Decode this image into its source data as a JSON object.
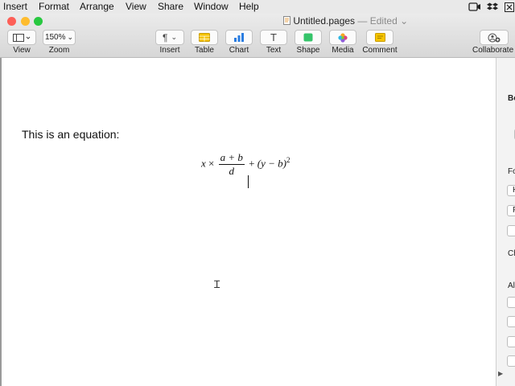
{
  "menubar": {
    "items": [
      "Insert",
      "Format",
      "Arrange",
      "View",
      "Share",
      "Window",
      "Help"
    ]
  },
  "window": {
    "title": "Untitled.pages",
    "status": "— Edited",
    "traffic_colors": [
      "#fd5f57",
      "#febc2e",
      "#28c840"
    ]
  },
  "toolbar": {
    "view_label": "View",
    "zoom_value": "150%",
    "zoom_label": "Zoom",
    "insert_label": "Insert",
    "table_label": "Table",
    "chart_label": "Chart",
    "text_label": "Text",
    "shape_label": "Shape",
    "media_label": "Media",
    "comment_label": "Comment",
    "collaborate_label": "Collaborate"
  },
  "document": {
    "body_text": "This is an equation:",
    "equation": {
      "x": "x",
      "times": "×",
      "numerator": "a + b",
      "denominator": "d",
      "plus": "+",
      "paren_expr": "(y − b)",
      "exponent": "2"
    }
  },
  "sidebar": {
    "fragments": [
      "Bo",
      "Fo",
      "Ch",
      "Al"
    ],
    "field_letters": [
      "H",
      "F"
    ]
  },
  "colors": {
    "table_icon": "#f5c400",
    "chart_icon": "#2a7de1",
    "shape_icon": "#35c46a",
    "comment_icon": "#f5c400"
  }
}
